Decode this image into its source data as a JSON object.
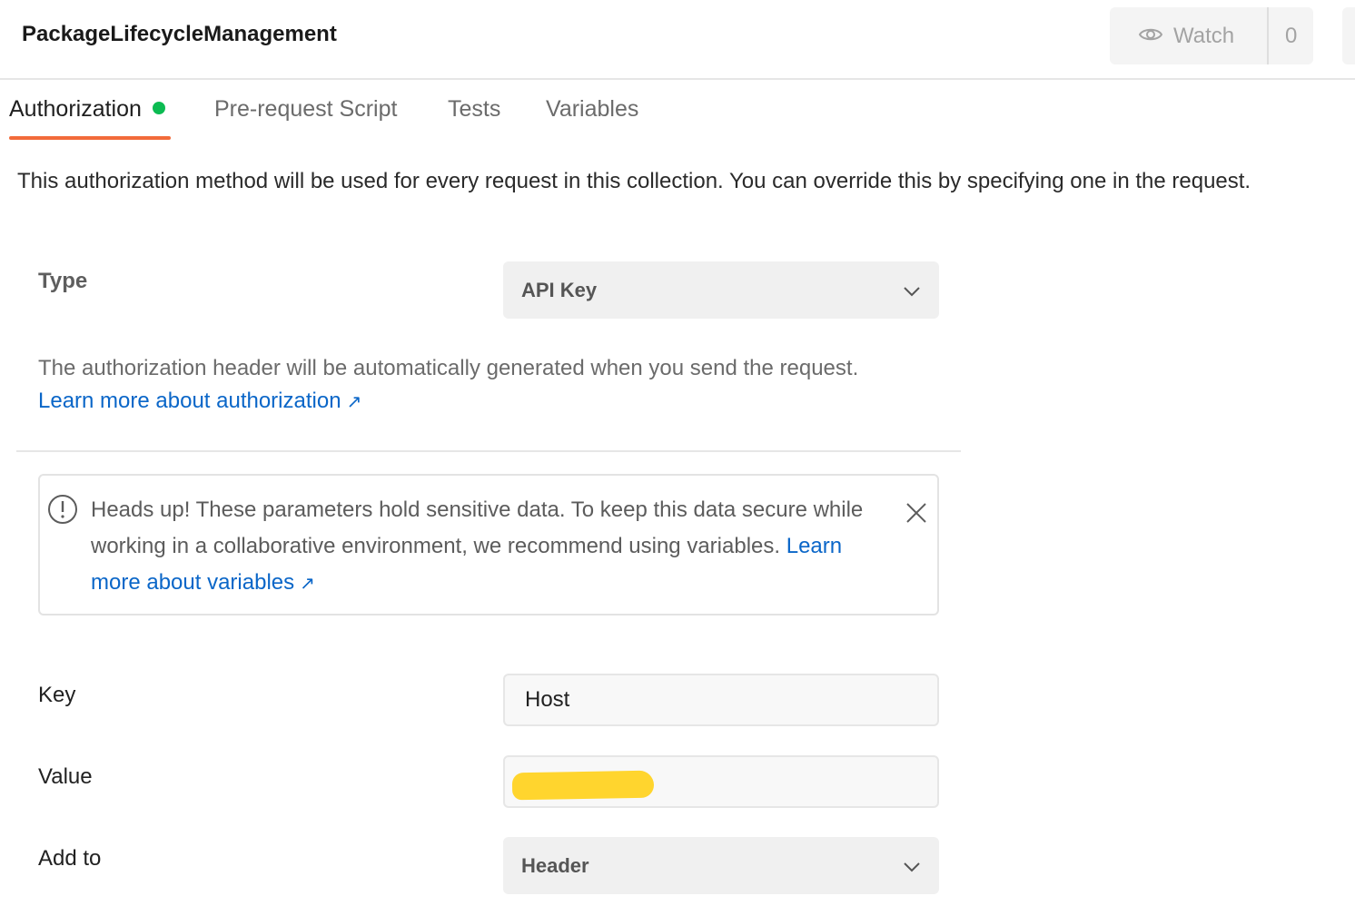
{
  "header": {
    "collection_title": "PackageLifecycleManagement",
    "watch_label": "Watch",
    "watch_count": "0"
  },
  "tabs": [
    {
      "label": "Authorization",
      "active": true,
      "status": "green-dot"
    },
    {
      "label": "Pre-request Script",
      "active": false
    },
    {
      "label": "Tests",
      "active": false
    },
    {
      "label": "Variables",
      "active": false
    }
  ],
  "description": "This authorization method will be used for every request in this collection. You can override this by specifying one in the request.",
  "type_field": {
    "label": "Type",
    "selected": "API Key",
    "icon": "chevron-down-icon"
  },
  "auth_note": {
    "text": "The authorization header will be automatically generated when you send the request.",
    "link": "Learn more about authorization",
    "link_icon": "external-arrow-icon"
  },
  "alert": {
    "icon": "info-circle-icon",
    "text": "Heads up! These parameters hold sensitive data. To keep this data secure while working in a collaborative environment, we recommend using variables.",
    "link": "Learn more about variables",
    "close_icon": "close-icon"
  },
  "key_field": {
    "label": "Key",
    "value": "Host"
  },
  "value_field": {
    "label": "Value",
    "value": "",
    "redacted": true,
    "redaction_color": "#ffd52e"
  },
  "add_to_field": {
    "label": "Add to",
    "selected": "Header",
    "icon": "chevron-down-icon"
  },
  "colors": {
    "accent_underline": "#f26b3a",
    "status_green": "#0cbb52",
    "link_blue": "#0a66c8"
  }
}
